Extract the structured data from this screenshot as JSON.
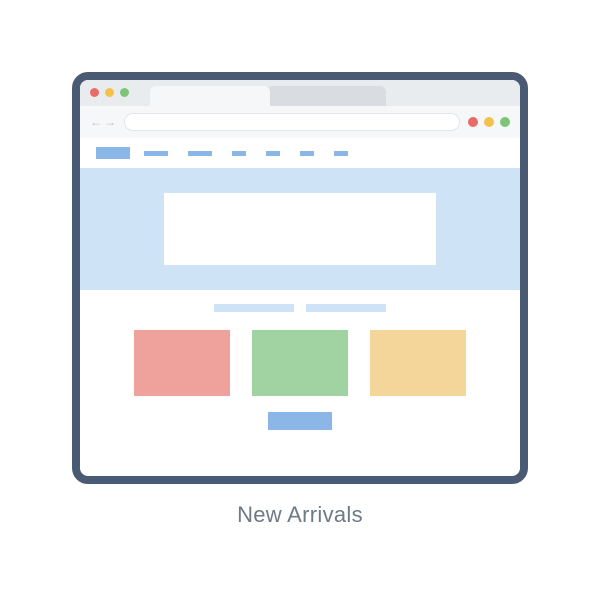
{
  "caption": "New Arrivals",
  "colors": {
    "frame": "#4b5a73",
    "traffic_red": "#e86b67",
    "traffic_yellow": "#f3c24b",
    "traffic_green": "#7cc576",
    "hero_bg": "#cfe3f7",
    "accent": "#8bb7e8",
    "card_red": "#efa29b",
    "card_green": "#a0d2a2",
    "card_yellow": "#f4d69a"
  }
}
